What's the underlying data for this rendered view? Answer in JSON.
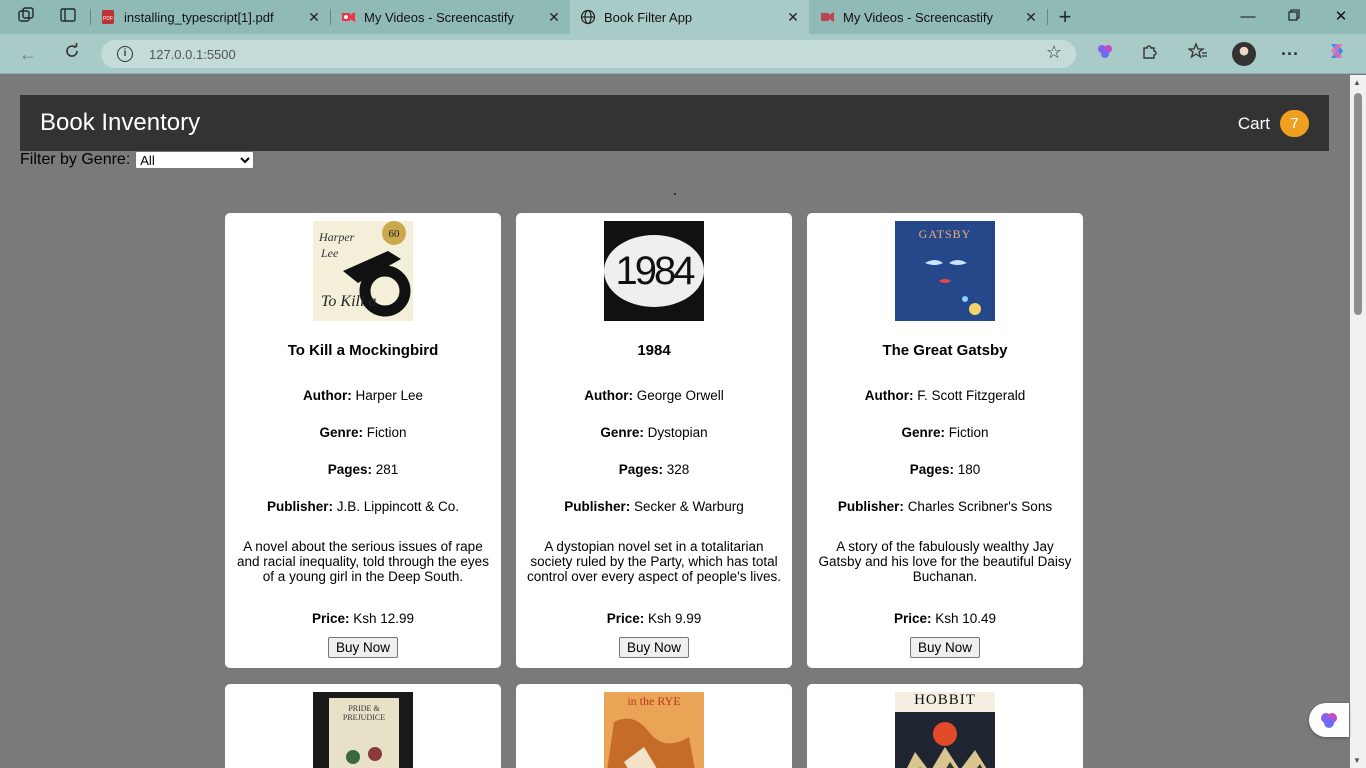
{
  "browser": {
    "tabs": [
      {
        "title": "installing_typescript[1].pdf",
        "active": false
      },
      {
        "title": "My Videos - Screencastify",
        "active": false
      },
      {
        "title": "Book Filter App",
        "active": true
      },
      {
        "title": "My Videos - Screencastify",
        "active": false
      }
    ],
    "address": {
      "host": "127.0.0.1",
      "port": ":5500"
    }
  },
  "app": {
    "brand": "Book Inventory",
    "cart_label": "Cart",
    "cart_count": "7",
    "filter_label": "Filter by Genre:",
    "filter_selected": "All"
  },
  "labels": {
    "author": "Author:",
    "genre": "Genre:",
    "pages": "Pages:",
    "publisher": "Publisher:",
    "price": "Price:",
    "buy": "Buy Now"
  },
  "books": [
    {
      "title": "To Kill a Mockingbird",
      "author": "Harper Lee",
      "genre": "Fiction",
      "pages": "281",
      "publisher": "J.B. Lippincott & Co.",
      "description": "A novel about the serious issues of rape and racial inequality, told through the eyes of a young girl in the Deep South.",
      "price": "Ksh 12.99",
      "cover_text": "To Kill a"
    },
    {
      "title": "1984",
      "author": "George Orwell",
      "genre": "Dystopian",
      "pages": "328",
      "publisher": "Secker & Warburg",
      "description": "A dystopian novel set in a totalitarian society ruled by the Party, which has total control over every aspect of people's lives.",
      "price": "Ksh 9.99",
      "cover_text": "1984"
    },
    {
      "title": "The Great Gatsby",
      "author": "F. Scott Fitzgerald",
      "genre": "Fiction",
      "pages": "180",
      "publisher": "Charles Scribner's Sons",
      "description": "A story of the fabulously wealthy Jay Gatsby and his love for the beautiful Daisy Buchanan.",
      "price": "Ksh 10.49",
      "cover_text": "GATSBY"
    }
  ],
  "partial_covers": [
    {
      "cover_text": "PRIDE & PREJUDICE"
    },
    {
      "cover_text": "in the RYE"
    },
    {
      "cover_text": "HOBBIT"
    }
  ]
}
